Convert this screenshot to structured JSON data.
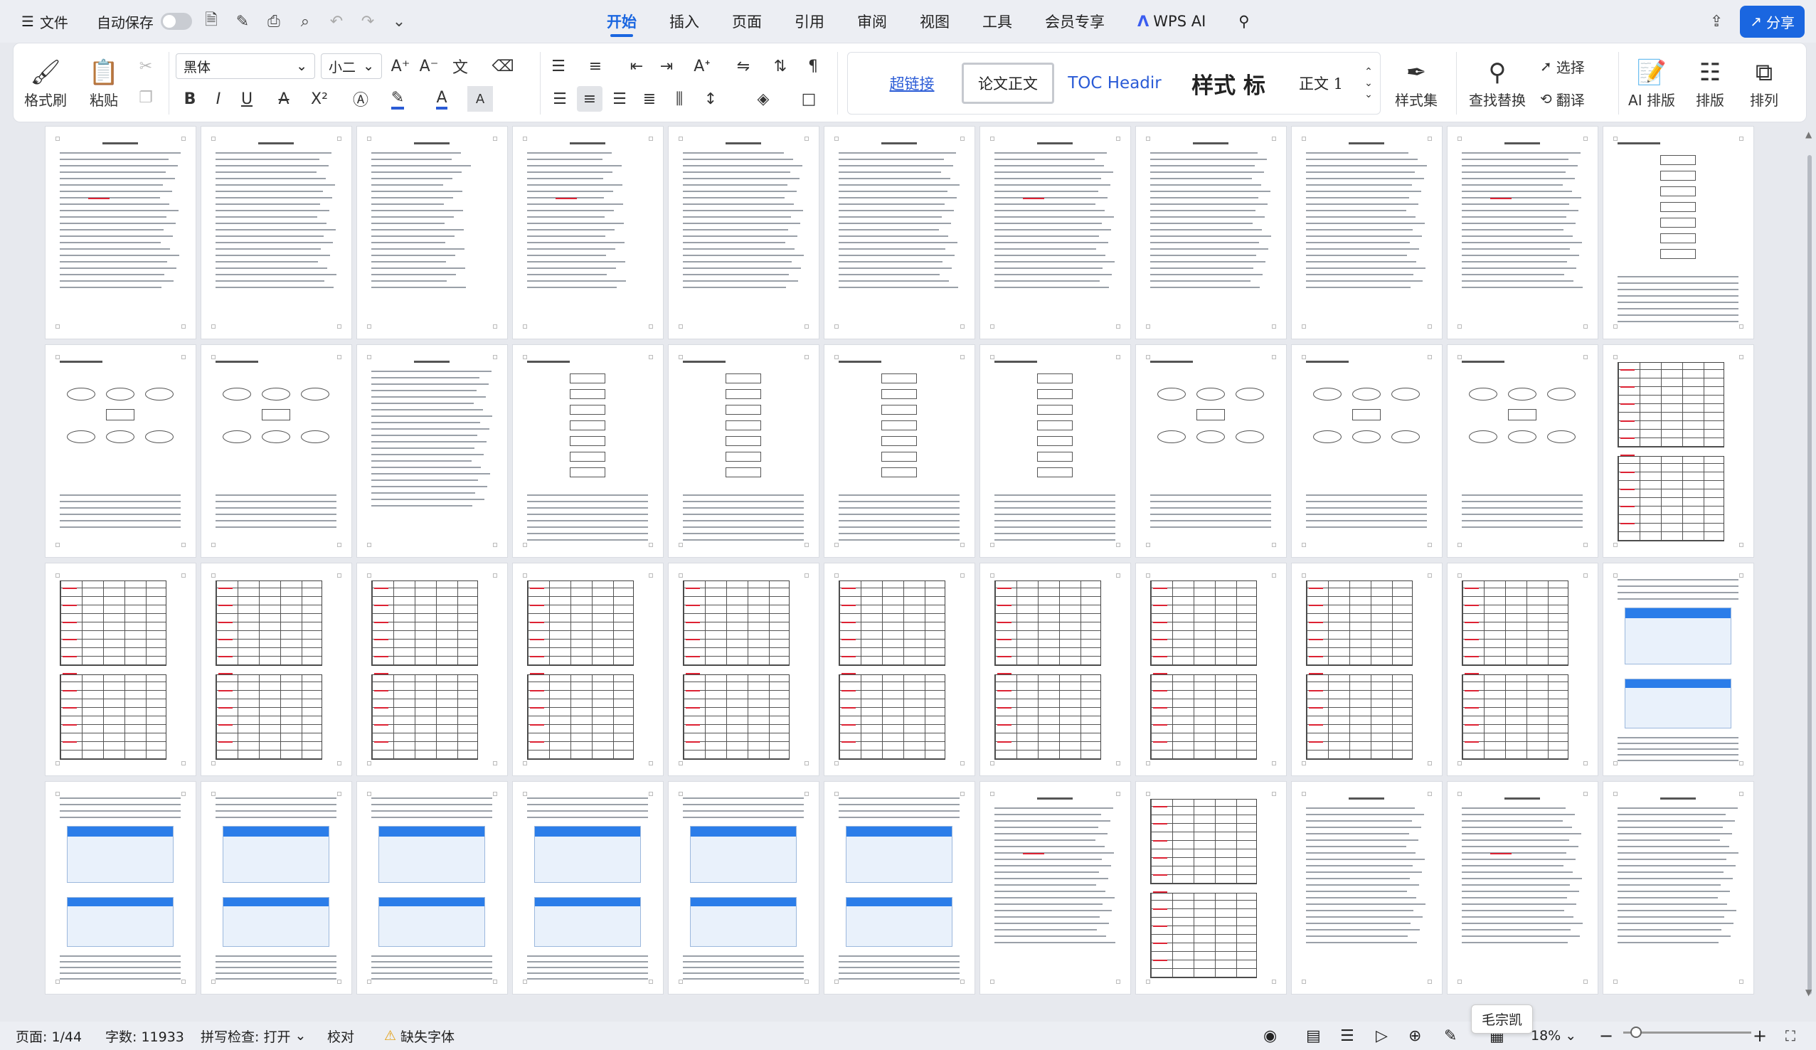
{
  "menubar": {
    "file_label": "文件",
    "autosave_label": "自动保存",
    "tabs": [
      "开始",
      "插入",
      "页面",
      "引用",
      "审阅",
      "视图",
      "工具",
      "会员专享",
      "WPS AI"
    ],
    "active_tab": "开始",
    "share_label": "分享",
    "accent_color": "#1a66e0"
  },
  "ribbon": {
    "format_painter": "格式刷",
    "paste": "粘贴",
    "font_name": "黑体",
    "font_size": "小二",
    "styles": {
      "hyperlink": "超链接",
      "thesis_body": "论文正文",
      "toc_heading": "TOC Headir",
      "heading_sample": "样式 标",
      "body1": "正文 1"
    },
    "style_set": "样式集",
    "find_replace": "查找替换",
    "select": "选择",
    "translate": "翻译",
    "ai_layout": "AI 排版",
    "layout": "排版",
    "arrange": "排列"
  },
  "thumbnails": {
    "rows": 4,
    "columns": 11,
    "total_pages": 44
  },
  "statusbar": {
    "page": "页面: 1/44",
    "word_count": "字数: 11933",
    "spell_check": "拼写检查: 打开",
    "proofread": "校对",
    "missing_font": "缺失字体",
    "zoom": "18%",
    "tooltip_user": "毛宗凯"
  }
}
